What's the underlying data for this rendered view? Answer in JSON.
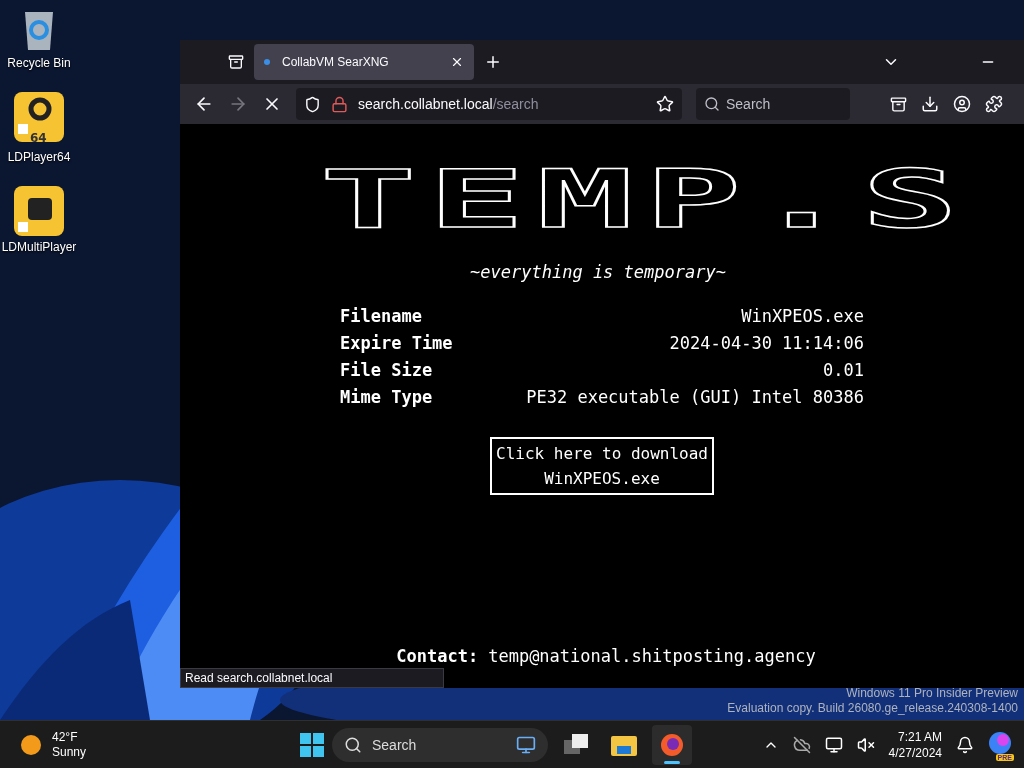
{
  "desktop_icons": [
    {
      "label": "Recycle Bin",
      "kind": "bin"
    },
    {
      "label": "LDPlayer64",
      "kind": "ldplayer",
      "badge": "64"
    },
    {
      "label": "LDMultiPlayer",
      "kind": "ldmulti"
    }
  ],
  "browser": {
    "tabs": [
      {
        "label": "CollabVM SearXNG",
        "selected": true
      }
    ],
    "address": {
      "domain": "search.collabnet.local",
      "path": "/search"
    },
    "search": {
      "placeholder": "Search"
    },
    "status": "Read search.collabnet.local"
  },
  "page": {
    "logo": "TEMP.S",
    "tagline": "~everything is temporary~",
    "details": [
      {
        "label": "Filename",
        "value": "WinXPEOS.exe"
      },
      {
        "label": "Expire Time",
        "value": "2024-04-30 11:14:06"
      },
      {
        "label": "File Size",
        "value": "0.01"
      },
      {
        "label": "Mime Type",
        "value": "PE32 executable (GUI) Intel 80386"
      }
    ],
    "download": [
      "Click here to download",
      "WinXPEOS.exe"
    ],
    "contact_label": "Contact:",
    "contact": "temp@national.shitposting.agency"
  },
  "watermark": [
    "Windows 11 Pro Insider Preview",
    "Evaluation copy. Build 26080.ge_release.240308-1400"
  ],
  "taskbar": {
    "weather": {
      "temp": "42°F",
      "condition": "Sunny"
    },
    "search": {
      "placeholder": "Search"
    },
    "apps": [
      {
        "kind": "taskview",
        "selected": false
      },
      {
        "kind": "explorer",
        "selected": false
      },
      {
        "kind": "firefox",
        "selected": true
      }
    ],
    "time": "7:21 AM",
    "date": "4/27/2024",
    "copilot_badge": "PRE"
  }
}
